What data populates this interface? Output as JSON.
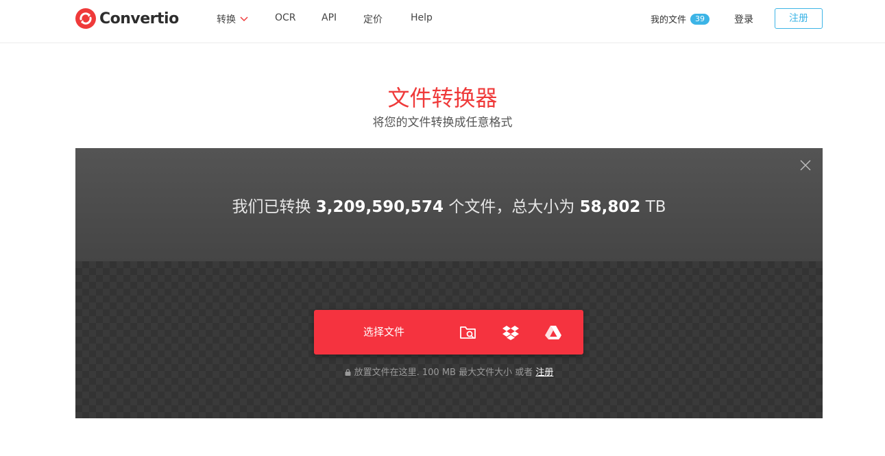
{
  "header": {
    "logo_text": "Convertio",
    "nav": {
      "convert": "转换",
      "ocr": "OCR",
      "api": "API",
      "pricing": "定价",
      "help": "Help"
    },
    "my_files": {
      "label": "我的文件",
      "count": "39"
    },
    "login": "登录",
    "signup": "注册"
  },
  "hero": {
    "title": "文件转换器",
    "subtitle": "将您的文件转换成任意格式"
  },
  "panel": {
    "stats": {
      "prefix": "我们已转换",
      "files_count": "3,209,590,574",
      "middle": "个文件，总大小为",
      "size_value": "58,802",
      "size_unit": "TB"
    },
    "upload": {
      "choose_label": "选择文件",
      "sources": [
        "folder-search-icon",
        "dropbox-icon",
        "google-drive-icon"
      ]
    },
    "hint": {
      "text": "放置文件在这里. 100 MB 最大文件大小 或者",
      "link": "注册"
    }
  },
  "colors": {
    "brand_red": "#ef3a3a",
    "button_red": "#f5333f",
    "accent_blue": "#3cb4e6"
  }
}
